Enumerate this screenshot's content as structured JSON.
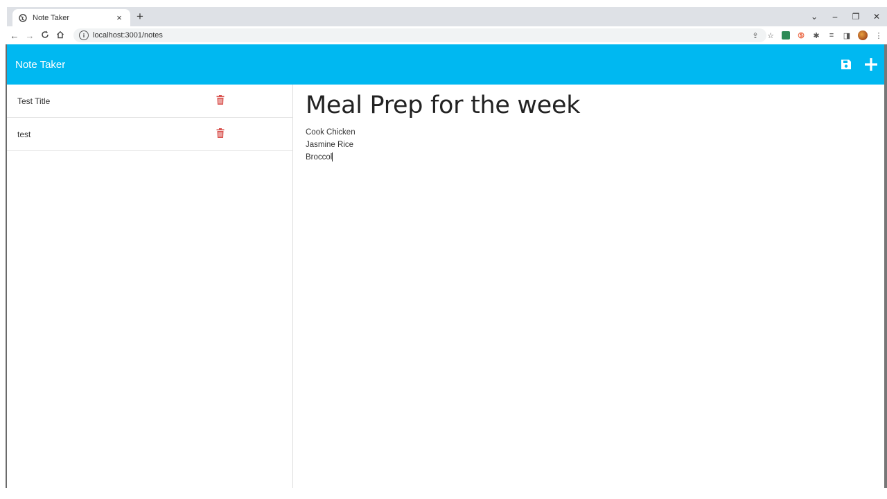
{
  "browser": {
    "tab_title": "Note Taker",
    "tab_close": "×",
    "new_tab": "+",
    "url": "localhost:3001/notes",
    "window_controls": [
      "⌄",
      "–",
      "❐",
      "✕"
    ]
  },
  "app": {
    "title": "Note Taker",
    "header_color": "#00b8f1",
    "save_icon": "save-icon",
    "new_note_icon": "plus-icon"
  },
  "notes": [
    {
      "title": "Test Title"
    },
    {
      "title": "test"
    }
  ],
  "active_note": {
    "title": "Meal Prep for the week",
    "text": "Cook Chicken\nJasmine Rice\nBroccol"
  },
  "colors": {
    "trash": "#d9534f"
  }
}
